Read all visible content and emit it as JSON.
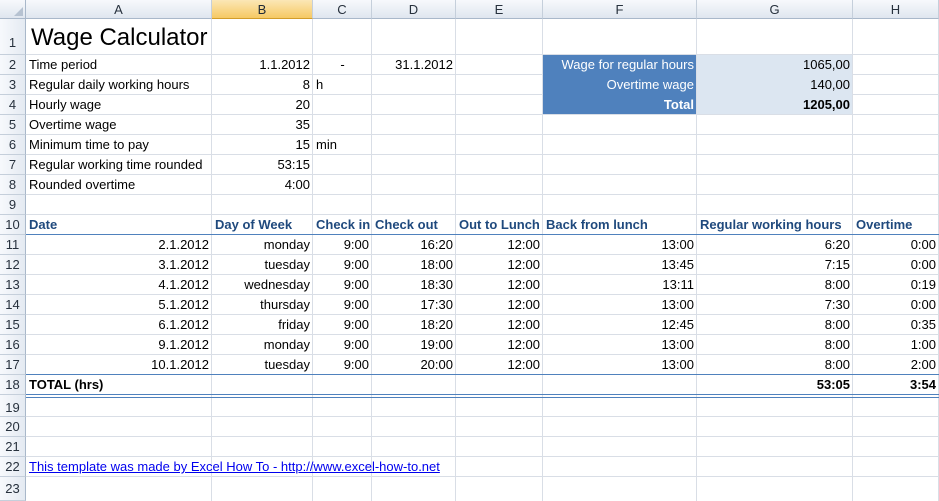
{
  "columns": [
    "A",
    "B",
    "C",
    "D",
    "E",
    "F",
    "G",
    "H"
  ],
  "rows": [
    "1",
    "2",
    "3",
    "4",
    "5",
    "6",
    "7",
    "8",
    "9",
    "10",
    "11",
    "12",
    "13",
    "14",
    "15",
    "16",
    "17",
    "18",
    "19",
    "20",
    "21",
    "22",
    "23"
  ],
  "title": "Wage Calculator",
  "params": {
    "time_period_label": "Time period",
    "time_period_start": "1.1.2012",
    "time_period_sep": "-",
    "time_period_end": "31.1.2012",
    "daily_hours_label": "Regular daily working hours",
    "daily_hours_value": "8",
    "daily_hours_unit": "h",
    "hourly_wage_label": "Hourly wage",
    "hourly_wage_value": "20",
    "overtime_wage_label": "Overtime wage",
    "overtime_wage_value": "35",
    "min_time_label": "Minimum time to pay",
    "min_time_value": "15",
    "min_time_unit": "min",
    "regular_rounded_label": "Regular working time rounded",
    "regular_rounded_value": "53:15",
    "rounded_overtime_label": "Rounded overtime",
    "rounded_overtime_value": "4:00"
  },
  "summary": {
    "regular_label": "Wage for regular hours",
    "regular_value": "1065,00",
    "overtime_label": "Overtime wage",
    "overtime_value": "140,00",
    "total_label": "Total",
    "total_value": "1205,00"
  },
  "table": {
    "headers": [
      "Date",
      "Day of Week",
      "Check in",
      "Check out",
      "Out to Lunch",
      "Back from lunch",
      "Regular working hours",
      "Overtime"
    ],
    "rows": [
      [
        "2.1.2012",
        "monday",
        "9:00",
        "16:20",
        "12:00",
        "13:00",
        "6:20",
        "0:00"
      ],
      [
        "3.1.2012",
        "tuesday",
        "9:00",
        "18:00",
        "12:00",
        "13:45",
        "7:15",
        "0:00"
      ],
      [
        "4.1.2012",
        "wednesday",
        "9:00",
        "18:30",
        "12:00",
        "13:11",
        "8:00",
        "0:19"
      ],
      [
        "5.1.2012",
        "thursday",
        "9:00",
        "17:30",
        "12:00",
        "13:00",
        "7:30",
        "0:00"
      ],
      [
        "6.1.2012",
        "friday",
        "9:00",
        "18:20",
        "12:00",
        "12:45",
        "8:00",
        "0:35"
      ],
      [
        "9.1.2012",
        "monday",
        "9:00",
        "19:00",
        "12:00",
        "13:00",
        "8:00",
        "1:00"
      ],
      [
        "10.1.2012",
        "tuesday",
        "9:00",
        "20:00",
        "12:00",
        "13:00",
        "8:00",
        "2:00"
      ]
    ],
    "total_label": "TOTAL (hrs)",
    "total_regular": "53:05",
    "total_overtime": "3:54"
  },
  "footer_link": "This template was made by Excel How To - http://www.excel-how-to.net",
  "colors": {
    "accent_blue": "#4f81bd",
    "light_blue": "#dce6f1",
    "header_text": "#1f497d",
    "selected_col": "#f6c964"
  }
}
